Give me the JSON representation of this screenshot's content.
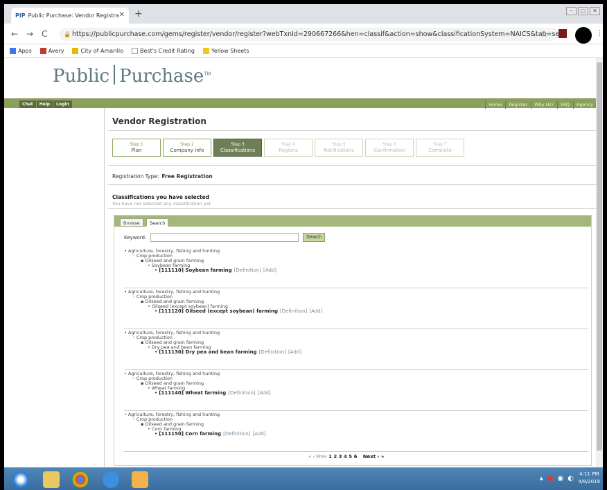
{
  "browser": {
    "tab_title": "Public Purchase: Vendor Registra",
    "tab_favicon": "PiP",
    "url": "https://publicpurchase.com/gems/register/vendor/register?webTxnId=290667266&hen=classif&action=show&classificationSystem=NAICS&tab=search&po...",
    "bookmarks": [
      {
        "label": "Apps",
        "color": "#3b78e7"
      },
      {
        "label": "Avery",
        "color": "#c0392b"
      },
      {
        "label": "City of Amarillo",
        "color": "#e6b800"
      },
      {
        "label": "Best's Credit Rating",
        "color": "#999999"
      },
      {
        "label": "Yellow Sheets",
        "color": "#f5c518"
      }
    ]
  },
  "site": {
    "logo_left": "Public",
    "logo_right": "Purchase",
    "logo_tm": "TM",
    "left_nav": [
      "Chat",
      "Help",
      "Login"
    ],
    "right_nav": [
      "Home",
      "Register",
      "Why Us?",
      "FAQ",
      "Agency"
    ]
  },
  "main": {
    "title": "Vendor Registration",
    "steps": [
      {
        "num": "Step 1",
        "label": "Plan",
        "state": "done"
      },
      {
        "num": "Step 2",
        "label": "Company Info",
        "state": "done"
      },
      {
        "num": "Step 3",
        "label": "Classifications",
        "state": "active"
      },
      {
        "num": "Step 4",
        "label": "Regions",
        "state": "disabled"
      },
      {
        "num": "Step 5",
        "label": "Notifications",
        "state": "disabled"
      },
      {
        "num": "Step 6",
        "label": "Confirmation",
        "state": "disabled"
      },
      {
        "num": "Step 7",
        "label": "Complete",
        "state": "disabled"
      }
    ],
    "reg_type_label": "Registration Type:",
    "reg_type_value": "Free Registration",
    "classifications_heading": "Classifications you have selected",
    "classifications_empty": "You have not selected any classification yet",
    "tabs": [
      "Browse",
      "Search"
    ],
    "keyword_label": "Keyword:",
    "keyword_value": "",
    "search_button": "Search",
    "results": [
      {
        "l1": "Agriculture, forestry, fishing and hunting",
        "l2": "Crop production",
        "l3": "Oilseed and grain farming",
        "l4": "Soybean farming",
        "code": "[111110] Soybean farming",
        "def": "[Definition]",
        "add": "[Add]"
      },
      {
        "l1": "Agriculture, forestry, fishing and hunting",
        "l2": "Crop production",
        "l3": "Oilseed and grain farming",
        "l4": "Oilseed (except soybean) farming",
        "code": "[111120] Oilseed (except soybean) farming",
        "def": "[Definition]",
        "add": "[Add]"
      },
      {
        "l1": "Agriculture, forestry, fishing and hunting",
        "l2": "Crop production",
        "l3": "Oilseed and grain farming",
        "l4": "Dry pea and bean farming",
        "code": "[111130] Dry pea and bean farming",
        "def": "[Definition]",
        "add": "[Add]"
      },
      {
        "l1": "Agriculture, forestry, fishing and hunting",
        "l2": "Crop production",
        "l3": "Oilseed and grain farming",
        "l4": "Wheat farming",
        "code": "[111140] Wheat farming",
        "def": "[Definition]",
        "add": "[Add]"
      },
      {
        "l1": "Agriculture, forestry, fishing and hunting",
        "l2": "Crop production",
        "l3": "Oilseed and grain farming",
        "l4": "Corn farming",
        "code": "[111150] Corn farming",
        "def": "[Definition]",
        "add": "[Add]"
      }
    ],
    "pager": {
      "prev": "« ‹ Prev",
      "pages": "1 2 3 4 5 6",
      "next": "Next › »"
    }
  },
  "taskbar": {
    "time": "4:11 PM",
    "date": "4/8/2019"
  }
}
